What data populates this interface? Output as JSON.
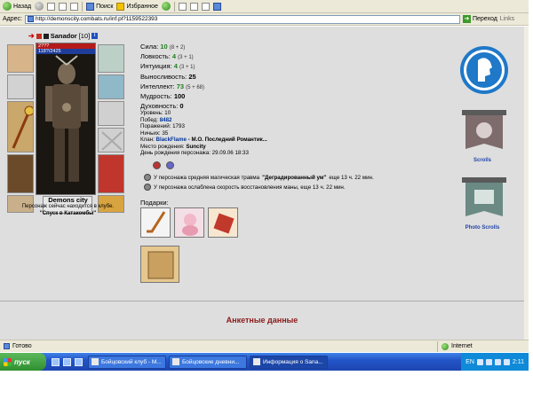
{
  "browser": {
    "back_label": "Назад",
    "search_label": "Поиск",
    "favorites_label": "Избранное",
    "address_label": "Адрес:",
    "url": "http://demonscity.combats.ru/inf.pl?1159522393",
    "go_label": "Переход",
    "links_label": "Links",
    "status_text": "Готово",
    "zone_text": "Internet"
  },
  "character": {
    "name": "Sanador",
    "level": "[10]",
    "hp": "2???",
    "mana": "118?/2425",
    "city": "Demons city",
    "in_club_text": "Персонаж сейчас находится в клубе.",
    "location": "\"Спуск в Катакомбы\""
  },
  "stats": [
    {
      "label": "Сила:",
      "value": "10",
      "bonus": "(8 + 2)",
      "green": true
    },
    {
      "label": "Ловкость:",
      "value": "4",
      "bonus": "(3 + 1)",
      "green": true
    },
    {
      "label": "Интуиция:",
      "value": "4",
      "bonus": "(3 + 1)",
      "green": true
    },
    {
      "label": "Выносливость:",
      "value": "25",
      "bonus": "",
      "green": false
    },
    {
      "label": "Интеллект:",
      "value": "73",
      "bonus": "(5 + 68)",
      "green": true
    },
    {
      "label": "Мудрость:",
      "value": "100",
      "bonus": "",
      "green": false
    },
    {
      "label": "Духовность:",
      "value": "0",
      "bonus": "",
      "green": false
    }
  ],
  "info": {
    "level": "Уровень: 10",
    "wins_label": "Побед:",
    "wins_value": "8482",
    "losses": "Поражений: 1793",
    "draws": "Ничьих: 35",
    "clan_label": "Клан:",
    "clan_value": "BlackFlame",
    "clan_rest": "- М.О. Последний Романтик...",
    "birthplace_label": "Место рождения:",
    "birthplace_value": "Suncity",
    "birthday": "День рождения персонажа: 29.09.06 18:33"
  },
  "effects": [
    {
      "text_pre": "У персонажа средняя магическая травма",
      "text_bold": "\"Деградированный ум\"",
      "text_post": "еще 13 ч. 22 мин."
    },
    {
      "text_pre": "У персонажа ослаблена скорость восстановления маны, еще 13 ч. 22 мин.",
      "text_bold": "",
      "text_post": ""
    }
  ],
  "gifts_title": "Подарки:",
  "side": {
    "scrolls_label": "Scrolls",
    "photo_scrolls_label": "Photo Scrolls"
  },
  "anket_title": "Анкетные данные",
  "taskbar": {
    "start_label": "пуск",
    "tasks": [
      "Бойцовский клуб - М...",
      "Бойцовские дневни...",
      "Информация о Sana..."
    ],
    "lang": "EN",
    "clock": "2:11"
  },
  "colors": {
    "stat_green": "#1e7f1e",
    "link_blue": "#003399",
    "anket_red": "#8b1a1a",
    "taskbar_blue": "#2355c8",
    "start_green": "#2f8f2f"
  }
}
